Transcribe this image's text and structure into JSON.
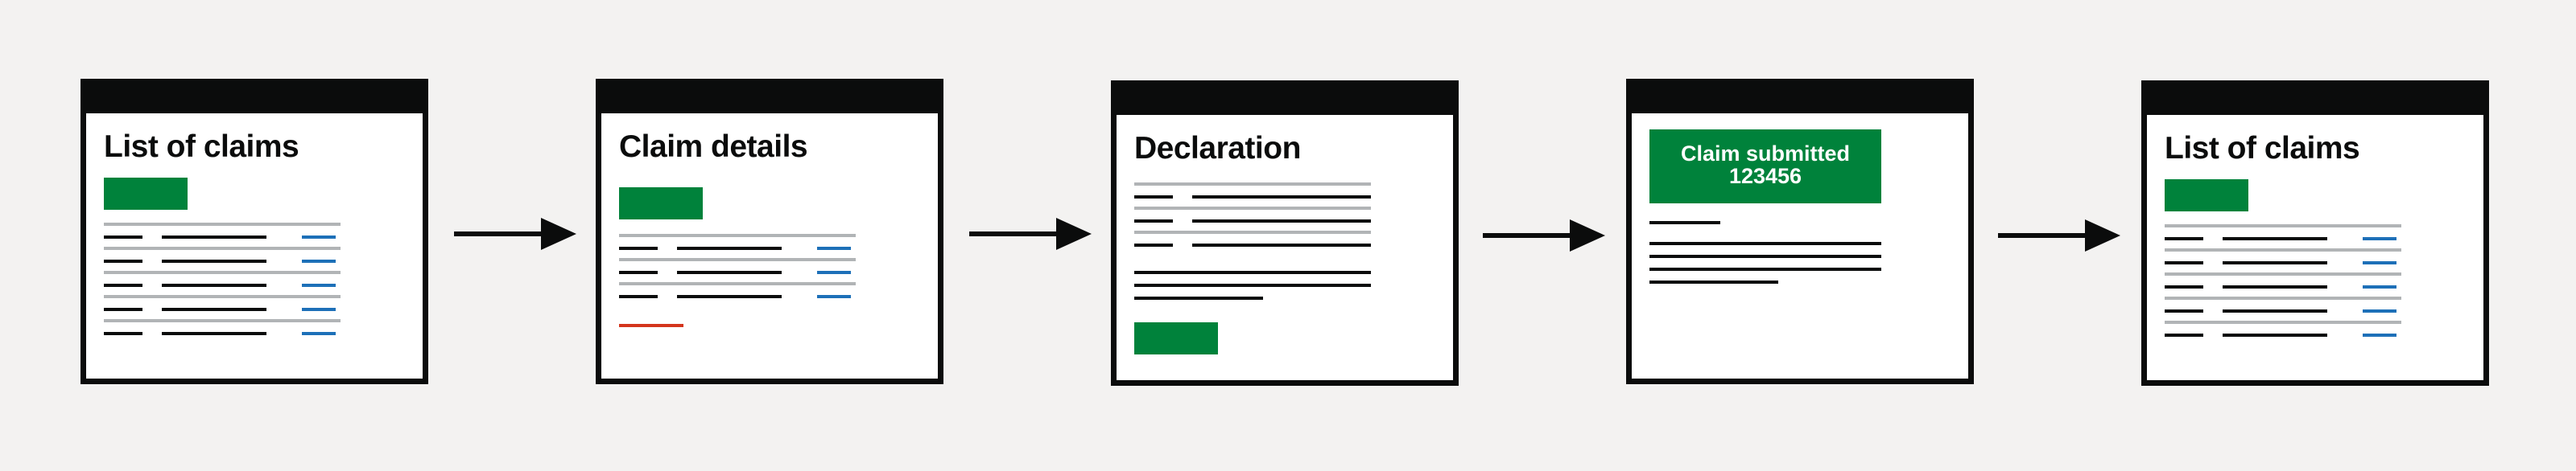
{
  "screens": [
    {
      "title": "List of claims"
    },
    {
      "title": "Claim details"
    },
    {
      "title": "Declaration"
    },
    {
      "banner_line1": "Claim submitted",
      "banner_line2": "123456"
    },
    {
      "title": "List of claims"
    }
  ],
  "colors": {
    "background": "#f3f2f1",
    "frame": "#0b0c0c",
    "button_green": "#00823b",
    "link_blue": "#1d70b8",
    "error_red": "#d4351c",
    "divider_grey": "#b1b4b6"
  }
}
